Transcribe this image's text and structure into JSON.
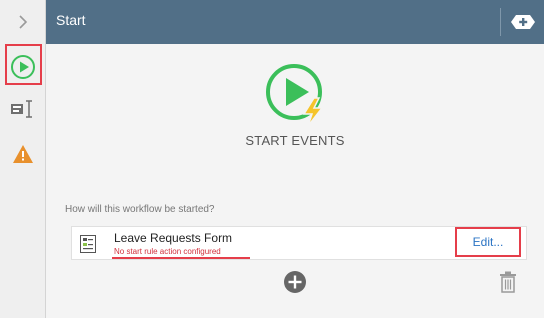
{
  "header": {
    "title": "Start"
  },
  "main": {
    "hero_title": "START EVENTS",
    "question": "How will this workflow be started?",
    "form": {
      "name": "Leave Requests Form",
      "status": "No start rule action configured",
      "edit_label": "Edit..."
    }
  },
  "icons": {
    "collapse": "chevron-right-icon",
    "start": "play-icon",
    "form": "form-control-icon",
    "warning": "warning-icon",
    "header_add": "add-icon",
    "hero": "start-event-icon",
    "add": "add-circle-icon",
    "trash": "trash-icon"
  },
  "colors": {
    "header_bg": "#516f87",
    "accent_green": "#3bbf5a",
    "bolt_yellow": "#f5c42a",
    "warning_orange": "#e8902c",
    "highlight_red": "#e53e4a",
    "link_blue": "#2b74c4"
  }
}
